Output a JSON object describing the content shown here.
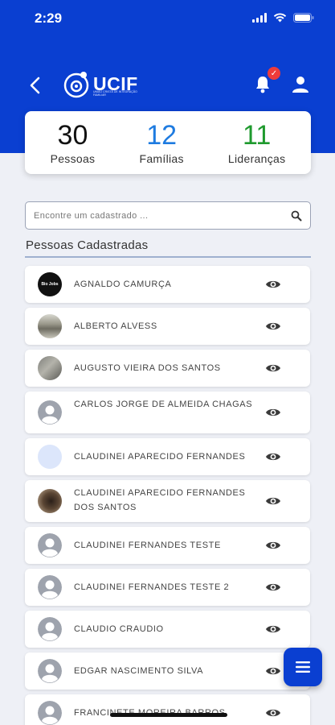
{
  "status": {
    "time": "2:29"
  },
  "header": {
    "logo_text": "UCIF",
    "logo_subtitle": "UNIÃO CRISTÃ DE INTEGRAÇÃO FAMILIAR",
    "badge_text": "✓"
  },
  "stats": [
    {
      "value": "30",
      "label": "Pessoas",
      "color": "#111111"
    },
    {
      "value": "12",
      "label": "Famílias",
      "color": "#1e7be0"
    },
    {
      "value": "11",
      "label": "Lideranças",
      "color": "#1f9a2e"
    }
  ],
  "search": {
    "placeholder": "Encontre um cadastrado ..."
  },
  "section_title": "Pessoas Cadastradas",
  "people": [
    {
      "name": "AGNALDO CAMURÇA",
      "avatar": "photo-dark",
      "avatar_text": "Bio Jobs"
    },
    {
      "name": "ALBERTO ALVESS",
      "avatar": "photo-grey"
    },
    {
      "name": "AUGUSTO VIEIRA DOS SANTOS",
      "avatar": "photo-wall"
    },
    {
      "name": "CARLOS JORGE DE ALMEIDA CHAGAS",
      "avatar": "placeholder"
    },
    {
      "name": "CLAUDINEI APARECIDO FERNANDES",
      "avatar": "light-blue"
    },
    {
      "name": "CLAUDINEI APARECIDO FERNANDES DOS SANTOS",
      "avatar": "photo-brown"
    },
    {
      "name": "CLAUDINEI FERNANDES TESTE",
      "avatar": "placeholder"
    },
    {
      "name": "CLAUDINEI FERNANDES TESTE 2",
      "avatar": "placeholder"
    },
    {
      "name": "CLAUDIO CRAUDIO",
      "avatar": "placeholder"
    },
    {
      "name": "EDGAR NASCIMENTO SILVA",
      "avatar": "placeholder"
    },
    {
      "name": "FRANCINETE MOREIRA BARROS",
      "avatar": "placeholder"
    }
  ],
  "colors": {
    "primary": "#0a3fd1",
    "background": "#eef0f6",
    "badge": "#ee3b3b"
  }
}
